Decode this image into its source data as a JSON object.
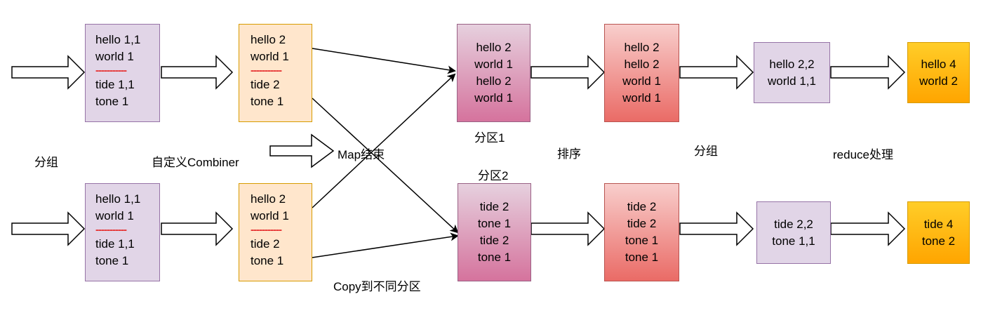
{
  "group1": {
    "box1": {
      "top": [
        "hello 1,1",
        "world 1"
      ],
      "sep": "-----------",
      "bottom": [
        "tide 1,1",
        "tone 1"
      ]
    },
    "box2": {
      "top": [
        "hello 2",
        "world 1"
      ],
      "sep": "-----------",
      "bottom": [
        "tide 2",
        "tone 1"
      ]
    },
    "partition": [
      "hello 2",
      "world 1",
      "hello 2",
      "world 1"
    ],
    "sorted": [
      "hello 2",
      "hello 2",
      "world 1",
      "world 1"
    ],
    "grouped": [
      "hello 2,2",
      "world 1,1"
    ],
    "reduced": [
      "hello 4",
      "world 2"
    ]
  },
  "group2": {
    "box1": {
      "top": [
        "hello 1,1",
        "world 1"
      ],
      "sep": "-----------",
      "bottom": [
        "tide 1,1",
        "tone 1"
      ]
    },
    "box2": {
      "top": [
        "hello 2",
        "world 1"
      ],
      "sep": "-----------",
      "bottom": [
        "tide 2",
        "tone 1"
      ]
    },
    "partition": [
      "tide 2",
      "tone 1",
      "tide 2",
      "tone 1"
    ],
    "sorted": [
      "tide 2",
      "tide 2",
      "tone 1",
      "tone 1"
    ],
    "grouped": [
      "tide 2,2",
      "tone 1,1"
    ],
    "reduced": [
      "tide 4",
      "tone 2"
    ]
  },
  "labels": {
    "group": "分组",
    "combiner": "自定义Combiner",
    "map_end": "Map结束",
    "partition1": "分区1",
    "partition2": "分区2",
    "sort": "排序",
    "group2": "分组",
    "reduce": "reduce处理",
    "copy": "Copy到不同分区"
  },
  "colors": {
    "purple_fill": "#e1d5e7",
    "orange_fill": "#ffe6cc",
    "pink_fill": "#d5739d",
    "red_fill": "#ea6b66",
    "gold_fill": "#ffb20f",
    "separator": "#e62e2e"
  }
}
